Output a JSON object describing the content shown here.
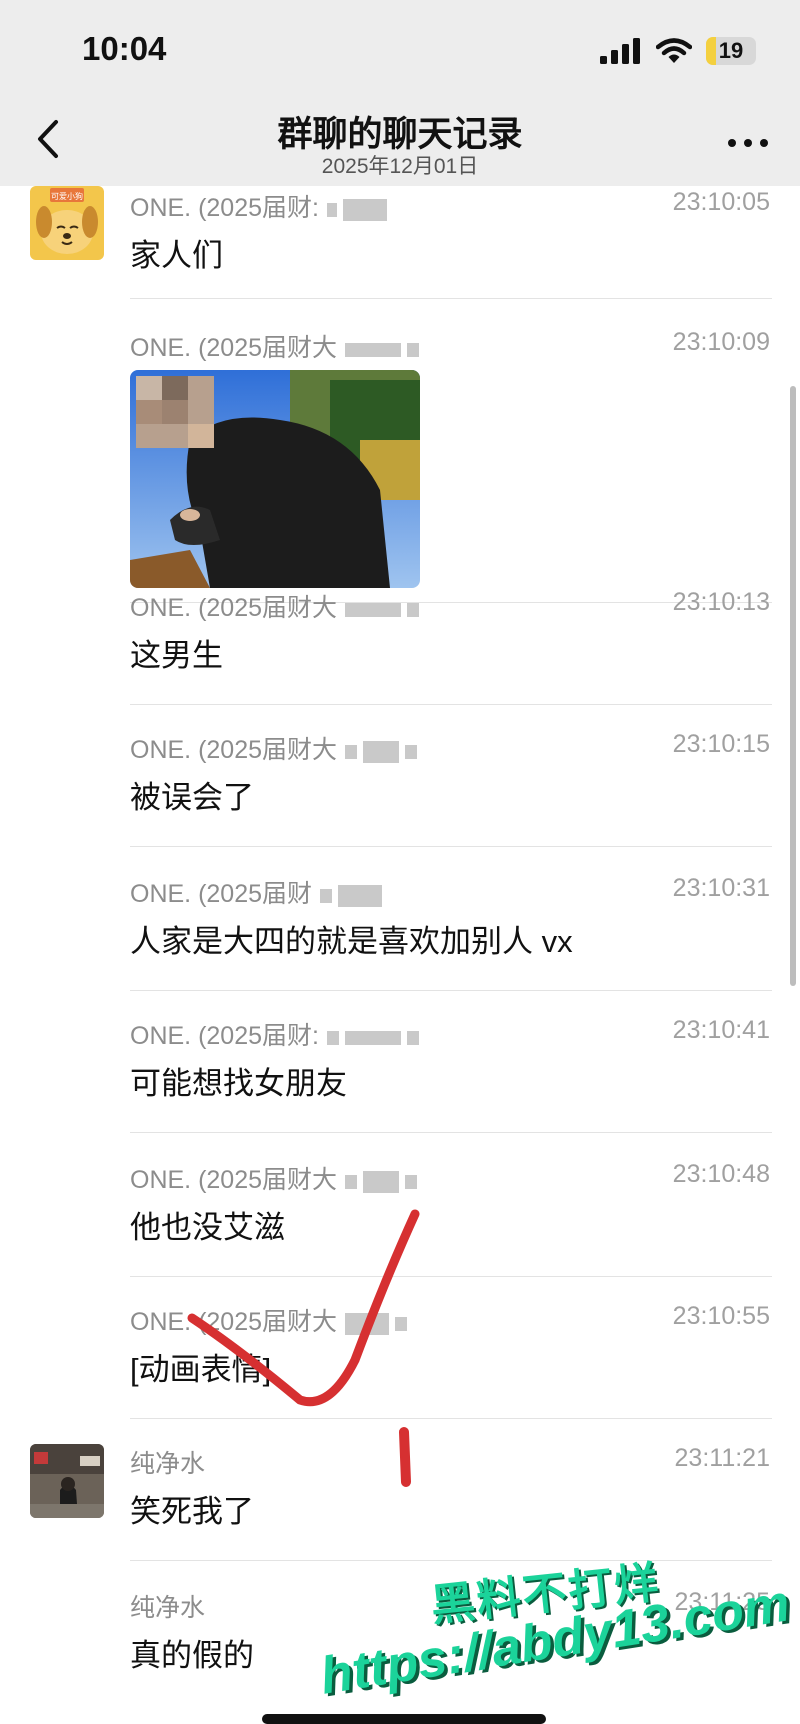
{
  "status": {
    "time": "10:04",
    "battery": "19",
    "battery_level": 0.19
  },
  "nav": {
    "title": "群聊的聊天记录",
    "subtitle": "2025年12月01日"
  },
  "messages": [
    {
      "sender": "ONE. (2025届财:",
      "time": "23:10:05",
      "text": "家人们"
    },
    {
      "sender": "ONE. (2025届财大",
      "time": "23:10:09",
      "text": ""
    },
    {
      "sender": "ONE. (2025届财大",
      "time": "23:10:13",
      "text": "这男生"
    },
    {
      "sender": "ONE. (2025届财大",
      "time": "23:10:15",
      "text": "被误会了"
    },
    {
      "sender": "ONE. (2025届财",
      "time": "23:10:31",
      "text": "人家是大四的就是喜欢加别人 vx"
    },
    {
      "sender": "ONE. (2025届财:",
      "time": "23:10:41",
      "text": "可能想找女朋友"
    },
    {
      "sender": "ONE. (2025届财大",
      "time": "23:10:48",
      "text": "他也没艾滋"
    },
    {
      "sender": "ONE. (2025届财大",
      "time": "23:10:55",
      "text": "[动画表情]"
    },
    {
      "sender": "纯净水",
      "time": "23:11:21",
      "text": "笑死我了"
    },
    {
      "sender": "纯净水",
      "time": "23:11:25",
      "text": "真的假的"
    }
  ],
  "avatar1_text": "可爱小狗",
  "watermark": {
    "line1": "黑料不打烊",
    "line2": "https://abdy13.com"
  },
  "colors": {
    "annotation_red": "#d63031",
    "watermark": "#1bd39a"
  }
}
